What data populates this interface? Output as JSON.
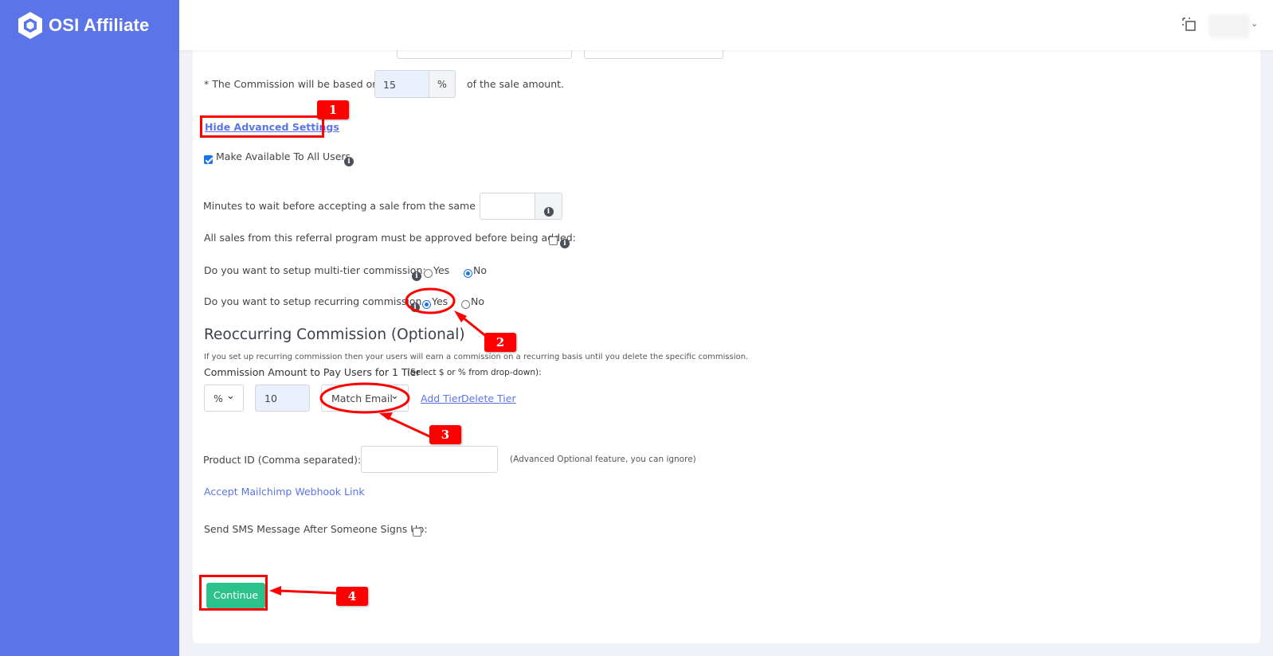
{
  "app": {
    "brand": "OSI Affiliate"
  },
  "header": {
    "icons": [
      "fullscreen-icon",
      "avatar",
      "chevron-down-icon"
    ]
  },
  "form": {
    "commission_label": "* The Commission will be based on",
    "commission_value": "15",
    "commission_unit": "%",
    "commission_suffix": "of the sale amount.",
    "advanced_link": "Hide Advanced Settings",
    "available_all_label": "Make Available To All Users",
    "minutes_label": "Minutes to wait before accepting a sale from the same IP:",
    "minutes_value": "",
    "approval_label": "All sales from this referral program must be approved before being added:",
    "multitier_label": "Do you want to setup multi-tier commission:",
    "multitier_selected": "No",
    "recurring_label": "Do you want to setup recurring commission",
    "recurring_selected": "Yes",
    "yes": "Yes",
    "no": "No",
    "section_title": "Reoccurring Commission (Optional)",
    "section_desc": "If you set up recurring commission then your users will earn a commission on a recurring basis until you delete the specific commission.",
    "tier_label": "Commission Amount to Pay Users for 1 Tier",
    "tier_hint": "(Select $ or % from drop-down):",
    "tier_type": "%",
    "tier_value": "10",
    "match_select": "Match Email",
    "add_tier": "Add Tier",
    "delete_tier": "Delete Tier",
    "product_label": "Product ID (Comma separated):",
    "product_value": "",
    "product_hint": "(Advanced Optional feature, you can ignore)",
    "mailchimp_link": "Accept Mailchimp Webhook Link",
    "sms_label": "Send SMS Message After Someone Signs Up:",
    "continue": "Continue"
  },
  "annotations": [
    "1",
    "2",
    "3",
    "4"
  ],
  "colors": {
    "sidebar": "#5b74e8",
    "annotation": "#ff0000",
    "continue": "#2cc28c",
    "link": "#5b74e8"
  }
}
